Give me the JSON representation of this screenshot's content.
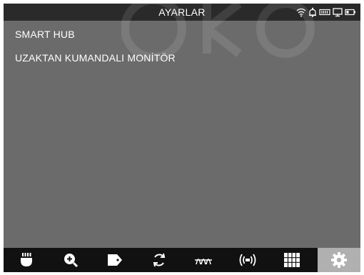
{
  "header": {
    "title": "AYARLAR",
    "status_icons": [
      "wifi-icon",
      "bell-icon",
      "storage-icon",
      "monitor-icon",
      "battery-icon"
    ]
  },
  "menu": {
    "items": [
      {
        "label": "SMART HUB"
      },
      {
        "label": "UZAKTAN KUMANDALI MONİTÖR"
      }
    ]
  },
  "toolbar": {
    "active_index": 7,
    "buttons": [
      {
        "icon": "brightness-cup-icon"
      },
      {
        "icon": "zoom-in-icon"
      },
      {
        "icon": "tag-icon"
      },
      {
        "icon": "rotate-icon"
      },
      {
        "icon": "filter-wave-icon"
      },
      {
        "icon": "signal-icon"
      },
      {
        "icon": "grid-icon"
      },
      {
        "icon": "settings-gear-icon"
      }
    ]
  },
  "colors": {
    "background": "#6b6b6b",
    "titlebar": "#2a2a2a",
    "toolbar": "#111111",
    "active_tab": "#b0b0b0",
    "text": "#ffffff"
  }
}
